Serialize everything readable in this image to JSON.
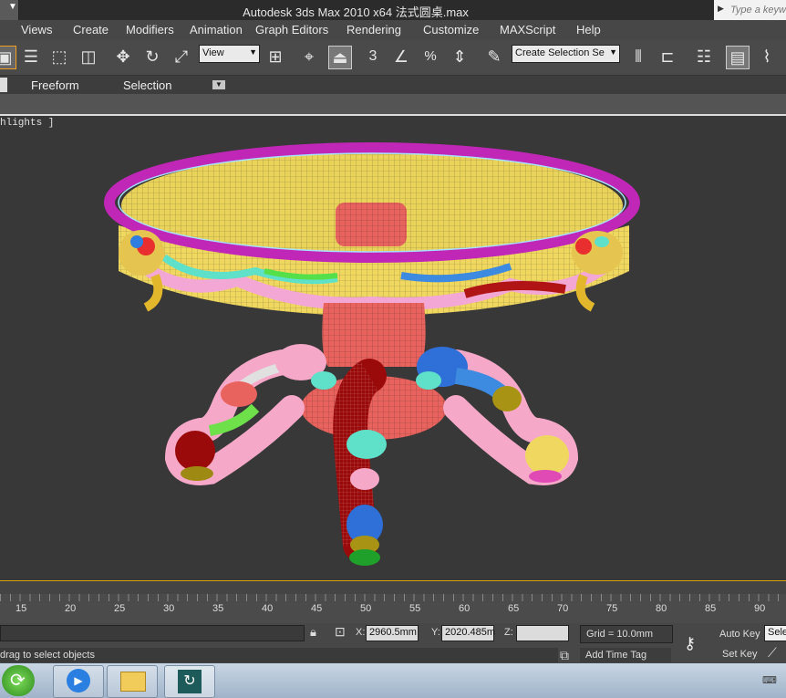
{
  "window": {
    "title": "Autodesk 3ds Max  2010 x64       法式圆桌.max",
    "search_placeholder": "Type a keyw"
  },
  "menu": [
    "Views",
    "Create",
    "Modifiers",
    "Animation",
    "Graph Editors",
    "Rendering",
    "Customize",
    "MAXScript",
    "Help"
  ],
  "toolbar": {
    "reference_coord": "View",
    "named_selection": "Create Selection Se",
    "snap_label": "3"
  },
  "ribbon": {
    "tabs": [
      "Freeform",
      "Selection"
    ]
  },
  "viewport": {
    "label": "hlights ]"
  },
  "timeline": {
    "ticks": [
      "15",
      "20",
      "25",
      "30",
      "35",
      "40",
      "45",
      "50",
      "55",
      "60",
      "65",
      "70",
      "75",
      "80",
      "85",
      "90"
    ]
  },
  "status": {
    "x_label": "X:",
    "x_value": "2960.5mm",
    "y_label": "Y:",
    "y_value": "2020.485m",
    "z_label": "Z:",
    "z_value": "",
    "grid": "Grid = 10.0mm",
    "prompt": "drag to select objects",
    "add_time_tag": "Add Time Tag",
    "auto_key": "Auto Key",
    "set_key": "Set Key",
    "selected": "Sele"
  },
  "colors": {
    "viewport_bg": "#383838",
    "accent": "#d9a300"
  }
}
